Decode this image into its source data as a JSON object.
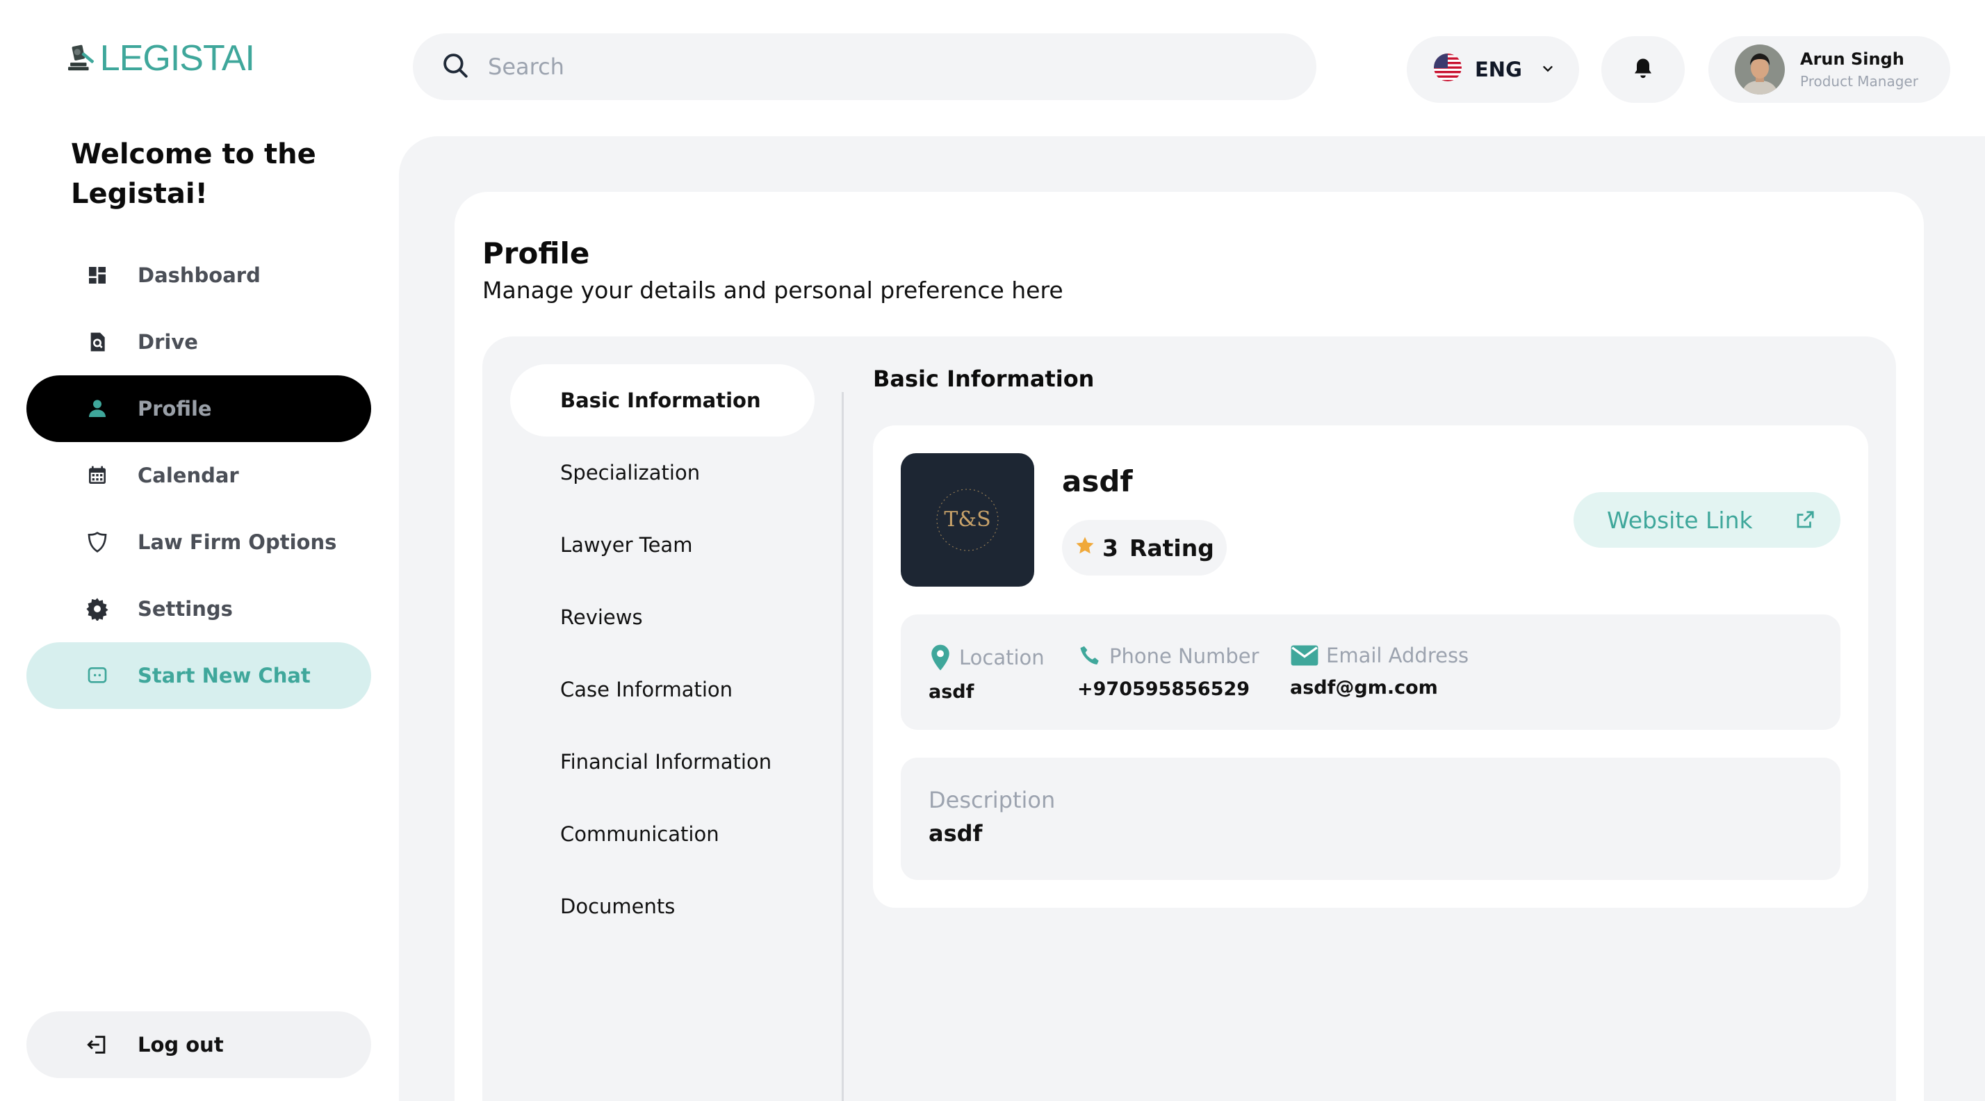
{
  "brand": {
    "logo_text": "LEGISTAI",
    "accent_color": "#3fa79b"
  },
  "sidebar": {
    "welcome": "Welcome to the Legistai!",
    "items": [
      {
        "label": "Dashboard",
        "icon": "dashboard-icon"
      },
      {
        "label": "Drive",
        "icon": "drive-icon"
      },
      {
        "label": "Profile",
        "icon": "person-icon",
        "active": true
      },
      {
        "label": "Calendar",
        "icon": "calendar-icon"
      },
      {
        "label": "Law Firm Options",
        "icon": "shield-icon"
      },
      {
        "label": "Settings",
        "icon": "gear-icon"
      },
      {
        "label": "Start New Chat",
        "icon": "chat-icon"
      }
    ],
    "logout_label": "Log out"
  },
  "topbar": {
    "search_placeholder": "Search",
    "language": "ENG",
    "user": {
      "name": "Arun Singh",
      "role": "Product Manager"
    }
  },
  "page": {
    "title": "Profile",
    "subtitle": "Manage your details and personal preference here"
  },
  "tabs": [
    {
      "label": "Basic Information",
      "active": true
    },
    {
      "label": "Specialization"
    },
    {
      "label": "Lawyer Team"
    },
    {
      "label": "Reviews"
    },
    {
      "label": "Case Information"
    },
    {
      "label": "Financial Information"
    },
    {
      "label": "Communication"
    },
    {
      "label": "Documents"
    }
  ],
  "basic_info": {
    "section_title": "Basic Information",
    "firm_logo_text": "T&S",
    "name": "asdf",
    "rating_value": "3",
    "rating_label": "Rating",
    "website_label": "Website Link",
    "location_label": "Location",
    "location_value": "asdf",
    "phone_label": "Phone Number",
    "phone_value": "+970595856529",
    "email_label": "Email Address",
    "email_value": "asdf@gm.com",
    "description_label": "Description",
    "description_value": "asdf"
  }
}
